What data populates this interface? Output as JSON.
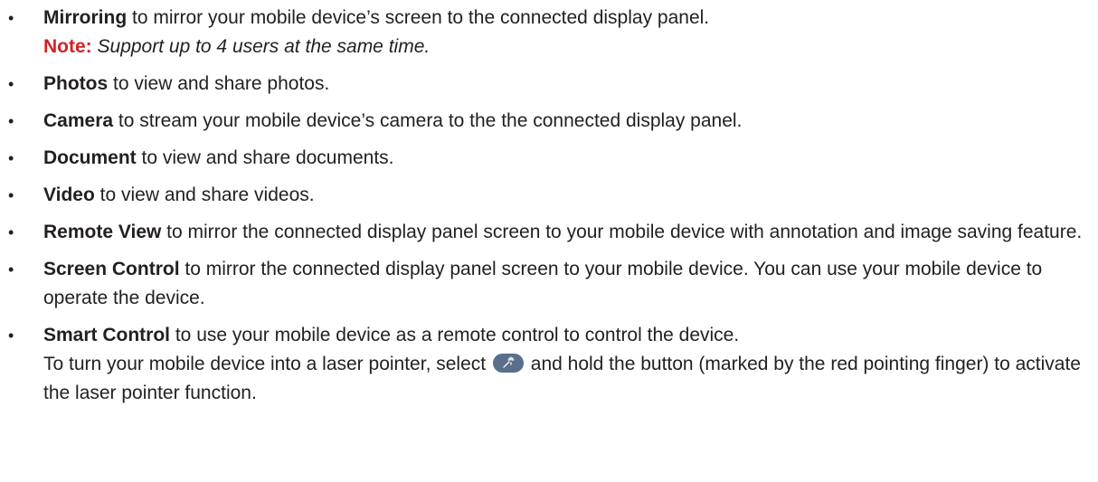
{
  "bullet_char": "•",
  "items": [
    {
      "term": "Mirroring",
      "text": " to mirror your mobile device’s screen to the connected display panel.",
      "note_label": "Note:",
      "note_text": " Support up to 4 users at the same time."
    },
    {
      "term": "Photos",
      "text": " to view and share photos."
    },
    {
      "term": "Camera",
      "text": " to stream your mobile device’s camera to the the connected display panel."
    },
    {
      "term": "Document",
      "text": " to view and share documents."
    },
    {
      "term": "Video",
      "text": " to view and share videos."
    },
    {
      "term": "Remote View",
      "text": " to mirror the connected display panel screen to your mobile device with annotation and image saving feature."
    },
    {
      "term": "Screen Control",
      "text": " to mirror the connected display panel screen to your mobile device. You can use your mobile device to operate the device."
    },
    {
      "term": "Smart Control",
      "text": " to use your mobile device as a remote control to control the device.",
      "extra_before": "To turn your mobile device into a laser pointer, select ",
      "laser_icon": "laser-pointer-icon",
      "extra_after": " and hold the button (marked by the red pointing finger) to activate the laser pointer function."
    }
  ],
  "colors": {
    "text": "#231f20",
    "note": "#d32128",
    "laser_button": "#5a6f8c"
  }
}
